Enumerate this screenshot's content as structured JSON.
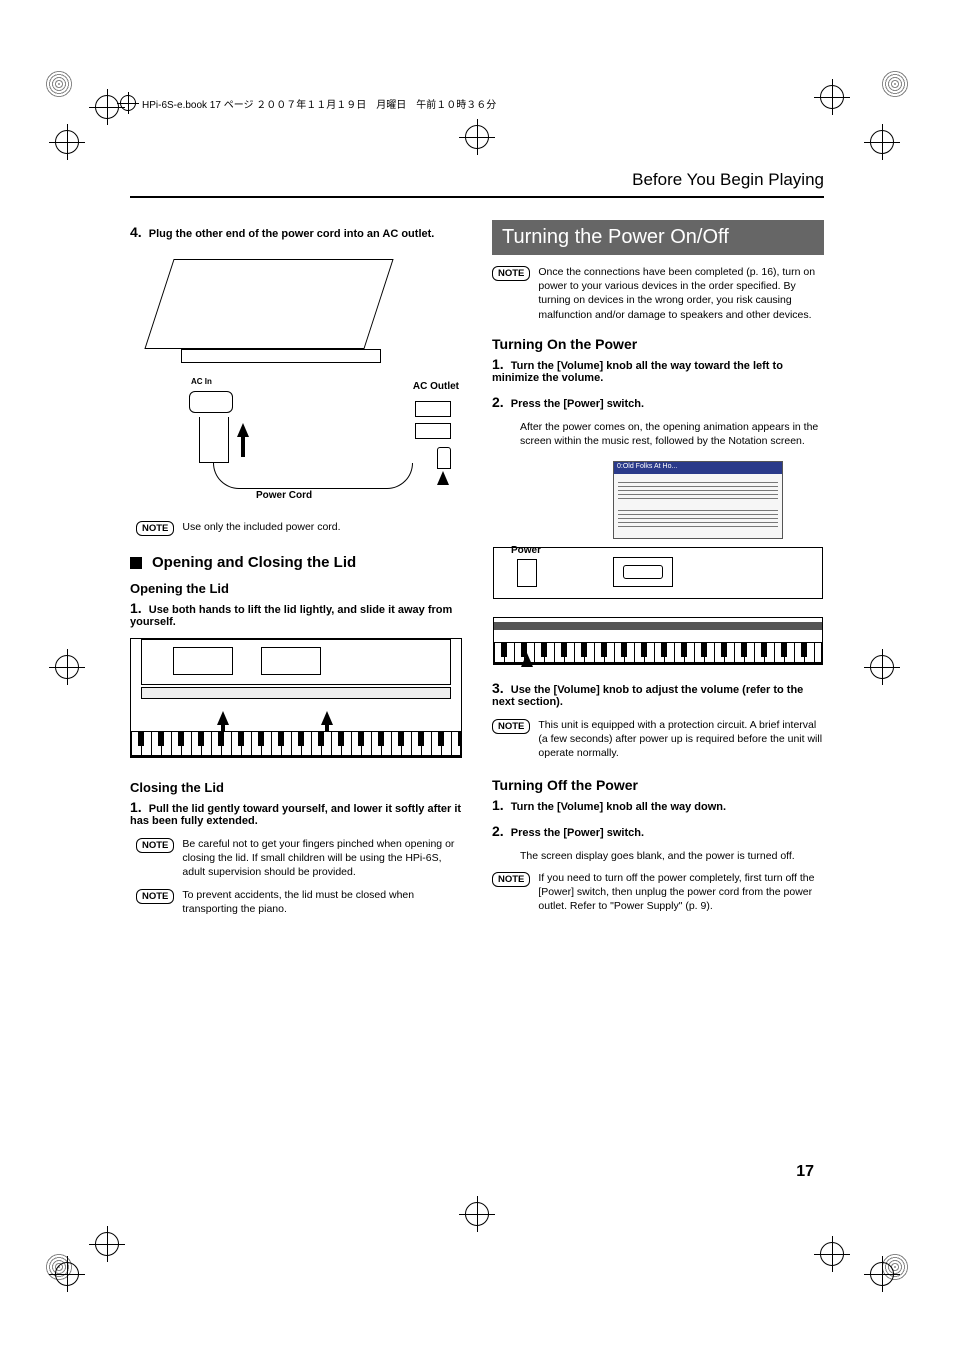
{
  "meta": {
    "header_line": "HPi-6S-e.book  17 ページ  ２００７年１１月１９日　月曜日　午前１０時３６分"
  },
  "header": {
    "title": "Before You Begin Playing"
  },
  "left": {
    "step4": {
      "num": "4.",
      "text": "Plug the other end of the power cord into an AC outlet."
    },
    "fig1": {
      "ac_in_label": "AC In",
      "ac_outlet_label": "AC Outlet",
      "power_cord_label": "Power Cord"
    },
    "note_powercord": {
      "badge": "NOTE",
      "text": "Use only the included power cord."
    },
    "subsection": "Opening and Closing the Lid",
    "opening_heading": "Opening the Lid",
    "opening_step1": {
      "num": "1.",
      "text": "Use both hands to lift the lid lightly, and slide it away from yourself."
    },
    "closing_heading": "Closing the Lid",
    "closing_step1": {
      "num": "1.",
      "text": "Pull the lid gently toward yourself, and lower it softly after it has been fully extended."
    },
    "note_fingers": {
      "badge": "NOTE",
      "text": "Be careful not to get your fingers pinched when opening or closing the lid. If small children will be using the HPi-6S, adult supervision should be provided."
    },
    "note_transport": {
      "badge": "NOTE",
      "text": "To prevent accidents, the lid must be closed when transporting the piano."
    }
  },
  "right": {
    "banner": "Turning the Power On/Off",
    "note_top": {
      "badge": "NOTE",
      "text": "Once the connections have been completed (p. 16), turn on power to your various devices in the order specified. By turning on devices in the wrong order, you risk causing malfunction and/or damage to speakers and other devices."
    },
    "on_heading": "Turning On the Power",
    "on_step1": {
      "num": "1.",
      "text": "Turn the [Volume] knob all the way toward the left to minimize the volume."
    },
    "on_step2": {
      "num": "2.",
      "text": "Press the [Power] switch."
    },
    "on_step2_body": "After the power comes on, the opening animation appears in the screen within the music rest, followed by the Notation screen.",
    "fig3": {
      "power_label": "Power",
      "notation_title": "0:Old Folks At Ho..."
    },
    "on_step3": {
      "num": "3.",
      "text": "Use the [Volume] knob to adjust the volume (refer to the next section)."
    },
    "note_protection": {
      "badge": "NOTE",
      "text": "This unit is equipped with a protection circuit. A brief interval (a few seconds) after power up is required before the unit will operate normally."
    },
    "off_heading": "Turning Off the Power",
    "off_step1": {
      "num": "1.",
      "text": "Turn the [Volume] knob all the way down."
    },
    "off_step2": {
      "num": "2.",
      "text": "Press the [Power] switch."
    },
    "off_step2_body": "The screen display goes blank, and the power is turned off.",
    "note_unplug": {
      "badge": "NOTE",
      "text": "If you need to turn off the power completely, first turn off the [Power] switch, then unplug the power cord from the power outlet. Refer to \"Power Supply\" (p. 9)."
    }
  },
  "page_number": "17"
}
